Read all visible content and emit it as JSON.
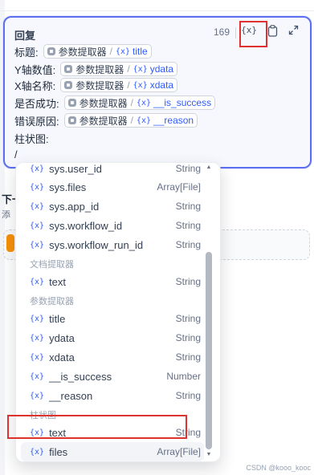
{
  "editor": {
    "title": "回复",
    "char_count": "169",
    "var_button_icon": "{x}",
    "lines": [
      {
        "label": "标题:",
        "node": "参数提取器",
        "var": "title"
      },
      {
        "label": "Y轴数值:",
        "node": "参数提取器",
        "var": "ydata"
      },
      {
        "label": "X轴名称:",
        "node": "参数提取器",
        "var": "xdata"
      },
      {
        "label": "是否成功:",
        "node": "参数提取器",
        "var": "__is_success"
      },
      {
        "label": "错误原因:",
        "node": "参数提取器",
        "var": "__reason"
      }
    ],
    "chart_line": "柱状图:",
    "slash_line": "/"
  },
  "background": {
    "next_step": "下一步",
    "add_hint": "添",
    "tail_hint": "告"
  },
  "dropdown": {
    "x_icon": "{x}",
    "items": [
      {
        "name": "sys.user_id",
        "type": "String"
      },
      {
        "name": "sys.files",
        "type": "Array[File]"
      },
      {
        "name": "sys.app_id",
        "type": "String"
      },
      {
        "name": "sys.workflow_id",
        "type": "String"
      },
      {
        "name": "sys.workflow_run_id",
        "type": "String"
      }
    ],
    "group_doc": "文档提取器",
    "doc_items": [
      {
        "name": "text",
        "type": "String"
      }
    ],
    "group_param": "参数提取器",
    "param_items": [
      {
        "name": "title",
        "type": "String"
      },
      {
        "name": "ydata",
        "type": "String"
      },
      {
        "name": "xdata",
        "type": "String"
      },
      {
        "name": "__is_success",
        "type": "Number"
      },
      {
        "name": "__reason",
        "type": "String"
      }
    ],
    "group_chart": "柱状图",
    "chart_items": [
      {
        "name": "text",
        "type": "String"
      },
      {
        "name": "files",
        "type": "Array[File]"
      }
    ]
  },
  "icons": {
    "clipboard": "clipboard-icon",
    "expand": "expand-icon",
    "variable": "variable-icon",
    "node": "parameter-extractor-node-icon"
  },
  "colors": {
    "accent": "#5c6ff0",
    "variable_blue": "#2e5bff",
    "highlight_red": "#e03131"
  },
  "watermark": "CSDN @kooo_kooc"
}
